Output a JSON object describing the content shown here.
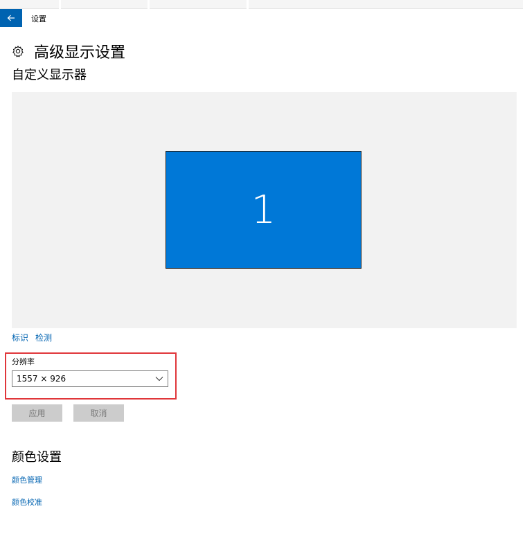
{
  "window": {
    "title": "设置"
  },
  "header": {
    "title": "高级显示设置",
    "icon": "gear-icon"
  },
  "customize": {
    "title": "自定义显示器",
    "monitor_number": "1",
    "identify_link": "标识",
    "detect_link": "检测"
  },
  "resolution": {
    "label": "分辨率",
    "selected": "1557 × 926",
    "highlight_color": "#e0363a"
  },
  "actions": {
    "apply_label": "应用",
    "cancel_label": "取消"
  },
  "color_settings": {
    "title": "颜色设置",
    "management_link": "颜色管理",
    "calibration_link": "颜色校准"
  },
  "colors": {
    "accent": "#0063b1",
    "monitor": "#0078d7",
    "canvas": "#f2f2f2"
  }
}
